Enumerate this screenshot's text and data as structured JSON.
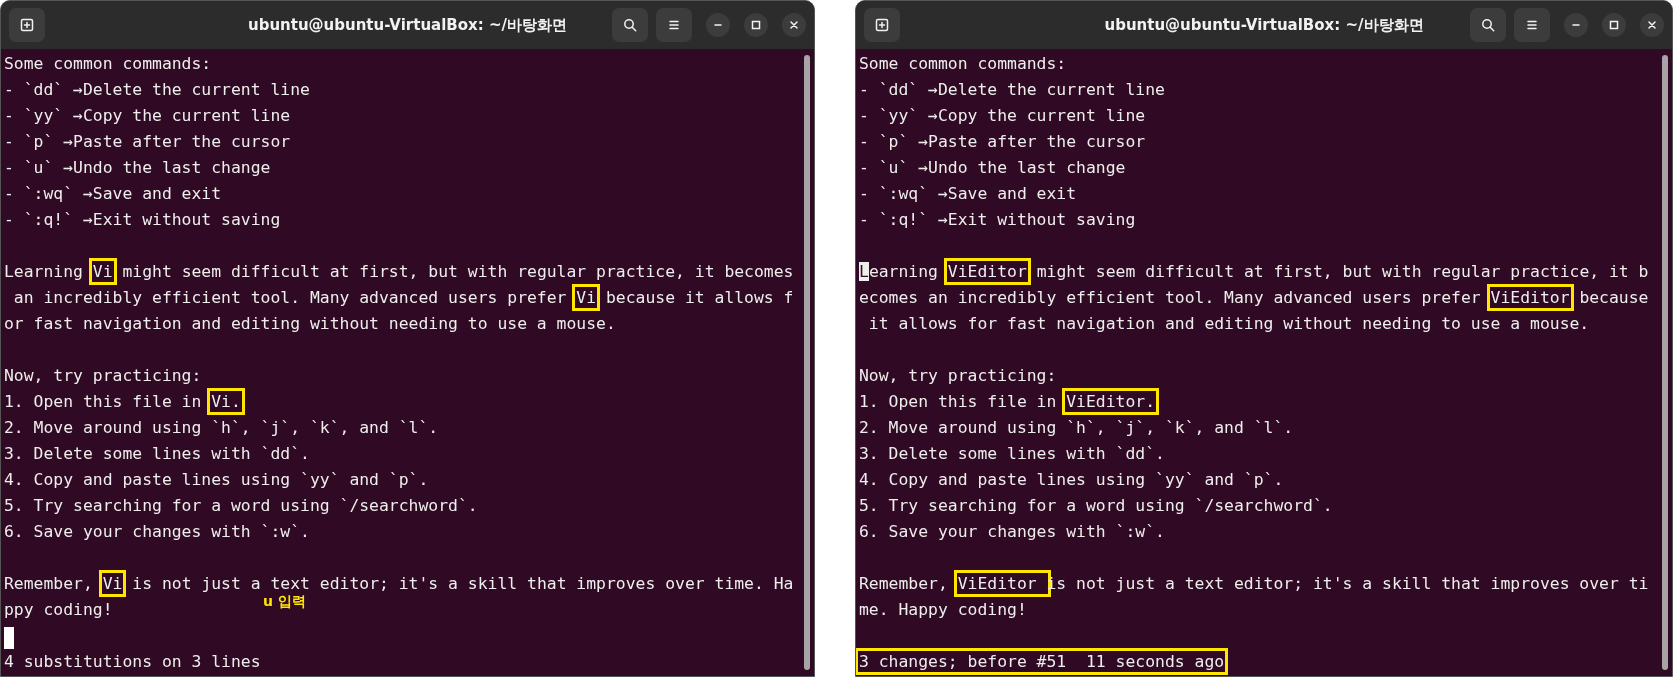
{
  "windows": [
    {
      "title": "ubuntu@ubuntu-VirtualBox: ~/바탕화면",
      "annotation": "u 입력",
      "lines": [
        {
          "kind": "text",
          "cursor": false,
          "segments": [
            {
              "text": "Some common commands:",
              "boxed": false
            }
          ]
        },
        {
          "kind": "text",
          "cursor": false,
          "segments": [
            {
              "text": "- `dd` →Delete the current line",
              "boxed": false
            }
          ]
        },
        {
          "kind": "text",
          "cursor": false,
          "segments": [
            {
              "text": "- `yy` →Copy the current line",
              "boxed": false
            }
          ]
        },
        {
          "kind": "text",
          "cursor": false,
          "segments": [
            {
              "text": "- `p` →Paste after the cursor",
              "boxed": false
            }
          ]
        },
        {
          "kind": "text",
          "cursor": false,
          "segments": [
            {
              "text": "- `u` →Undo the last change",
              "boxed": false
            }
          ]
        },
        {
          "kind": "text",
          "cursor": false,
          "segments": [
            {
              "text": "- `:wq` →Save and exit",
              "boxed": false
            }
          ]
        },
        {
          "kind": "text",
          "cursor": false,
          "segments": [
            {
              "text": "- `:q!` →Exit without saving",
              "boxed": false
            }
          ]
        },
        {
          "kind": "blank",
          "cursor": false
        },
        {
          "kind": "text",
          "cursor": false,
          "segments": [
            {
              "text": "Learning ",
              "boxed": false
            },
            {
              "text": "Vi",
              "boxed": true
            },
            {
              "text": " might seem difficult at first, but with regular practice, it becomes",
              "boxed": false
            }
          ]
        },
        {
          "kind": "text",
          "cursor": false,
          "segments": [
            {
              "text": " an incredibly efficient tool. Many advanced users prefer ",
              "boxed": false
            },
            {
              "text": "Vi",
              "boxed": true
            },
            {
              "text": " because it allows f",
              "boxed": false
            }
          ]
        },
        {
          "kind": "text",
          "cursor": false,
          "segments": [
            {
              "text": "or fast navigation and editing without needing to use a mouse.",
              "boxed": false
            }
          ]
        },
        {
          "kind": "blank",
          "cursor": false
        },
        {
          "kind": "text",
          "cursor": false,
          "segments": [
            {
              "text": "Now, try practicing:",
              "boxed": false
            }
          ]
        },
        {
          "kind": "text",
          "cursor": false,
          "segments": [
            {
              "text": "1. Open this file in ",
              "boxed": false
            },
            {
              "text": "Vi.",
              "boxed": true
            }
          ]
        },
        {
          "kind": "text",
          "cursor": false,
          "segments": [
            {
              "text": "2. Move around using `h`, `j`, `k`, and `l`.",
              "boxed": false
            }
          ]
        },
        {
          "kind": "text",
          "cursor": false,
          "segments": [
            {
              "text": "3. Delete some lines with `dd`.",
              "boxed": false
            }
          ]
        },
        {
          "kind": "text",
          "cursor": false,
          "segments": [
            {
              "text": "4. Copy and paste lines using `yy` and `p`.",
              "boxed": false
            }
          ]
        },
        {
          "kind": "text",
          "cursor": false,
          "segments": [
            {
              "text": "5. Try searching for a word using `/searchword`.",
              "boxed": false
            }
          ]
        },
        {
          "kind": "text",
          "cursor": false,
          "segments": [
            {
              "text": "6. Save your changes with `:w`.",
              "boxed": false
            }
          ]
        },
        {
          "kind": "blank",
          "cursor": false
        },
        {
          "kind": "text",
          "cursor": false,
          "segments": [
            {
              "text": "Remember, ",
              "boxed": false
            },
            {
              "text": "Vi",
              "boxed": true
            },
            {
              "text": " is not just a text editor; it's a skill that improves over time. Ha",
              "boxed": false
            }
          ]
        },
        {
          "kind": "text",
          "cursor": false,
          "segments": [
            {
              "text": "ppy coding!",
              "boxed": false
            }
          ]
        },
        {
          "kind": "blank",
          "cursor": true
        },
        {
          "kind": "text",
          "cursor": false,
          "segments": [
            {
              "text": "4 substitutions on 3 lines",
              "boxed": false
            }
          ]
        }
      ]
    },
    {
      "title": "ubuntu@ubuntu-VirtualBox: ~/바탕화면",
      "lines": [
        {
          "kind": "text",
          "cursor": false,
          "segments": [
            {
              "text": "Some common commands:",
              "boxed": false
            }
          ]
        },
        {
          "kind": "text",
          "cursor": false,
          "segments": [
            {
              "text": "- `dd` →Delete the current line",
              "boxed": false
            }
          ]
        },
        {
          "kind": "text",
          "cursor": false,
          "segments": [
            {
              "text": "- `yy` →Copy the current line",
              "boxed": false
            }
          ]
        },
        {
          "kind": "text",
          "cursor": false,
          "segments": [
            {
              "text": "- `p` →Paste after the cursor",
              "boxed": false
            }
          ]
        },
        {
          "kind": "text",
          "cursor": false,
          "segments": [
            {
              "text": "- `u` →Undo the last change",
              "boxed": false
            }
          ]
        },
        {
          "kind": "text",
          "cursor": false,
          "segments": [
            {
              "text": "- `:wq` →Save and exit",
              "boxed": false
            }
          ]
        },
        {
          "kind": "text",
          "cursor": false,
          "segments": [
            {
              "text": "- `:q!` →Exit without saving",
              "boxed": false
            }
          ]
        },
        {
          "kind": "blank",
          "cursor": false
        },
        {
          "kind": "text",
          "cursor": true,
          "segments": [
            {
              "text": "Learning ",
              "boxed": false
            },
            {
              "text": "ViEditor",
              "boxed": true
            },
            {
              "text": " might seem difficult at first, but with regular practice, it b",
              "boxed": false
            }
          ]
        },
        {
          "kind": "text",
          "cursor": false,
          "segments": [
            {
              "text": "ecomes an incredibly efficient tool. Many advanced users prefer ",
              "boxed": false
            },
            {
              "text": "ViEditor",
              "boxed": true
            },
            {
              "text": " because",
              "boxed": false
            }
          ]
        },
        {
          "kind": "text",
          "cursor": false,
          "segments": [
            {
              "text": " it allows for fast navigation and editing without needing to use a mouse.",
              "boxed": false
            }
          ]
        },
        {
          "kind": "blank",
          "cursor": false
        },
        {
          "kind": "text",
          "cursor": false,
          "segments": [
            {
              "text": "Now, try practicing:",
              "boxed": false
            }
          ]
        },
        {
          "kind": "text",
          "cursor": false,
          "segments": [
            {
              "text": "1. Open this file in ",
              "boxed": false
            },
            {
              "text": "ViEditor.",
              "boxed": true
            }
          ]
        },
        {
          "kind": "text",
          "cursor": false,
          "segments": [
            {
              "text": "2. Move around using `h`, `j`, `k`, and `l`.",
              "boxed": false
            }
          ]
        },
        {
          "kind": "text",
          "cursor": false,
          "segments": [
            {
              "text": "3. Delete some lines with `dd`.",
              "boxed": false
            }
          ]
        },
        {
          "kind": "text",
          "cursor": false,
          "segments": [
            {
              "text": "4. Copy and paste lines using `yy` and `p`.",
              "boxed": false
            }
          ]
        },
        {
          "kind": "text",
          "cursor": false,
          "segments": [
            {
              "text": "5. Try searching for a word using `/searchword`.",
              "boxed": false
            }
          ]
        },
        {
          "kind": "text",
          "cursor": false,
          "segments": [
            {
              "text": "6. Save your changes with `:w`.",
              "boxed": false
            }
          ]
        },
        {
          "kind": "blank",
          "cursor": false
        },
        {
          "kind": "text",
          "cursor": false,
          "segments": [
            {
              "text": "Remember, ",
              "boxed": false
            },
            {
              "text": "ViEditor ",
              "boxed": true
            },
            {
              "text": "is not just a text editor; it's a skill that improves over ti",
              "boxed": false
            }
          ]
        },
        {
          "kind": "text",
          "cursor": false,
          "segments": [
            {
              "text": "me. Happy coding!",
              "boxed": false
            }
          ]
        },
        {
          "kind": "blank",
          "cursor": false
        },
        {
          "kind": "text",
          "cursor": false,
          "segments": [
            {
              "text": "3 changes; before #51  11 seconds ago",
              "boxed": true
            }
          ]
        }
      ]
    }
  ]
}
